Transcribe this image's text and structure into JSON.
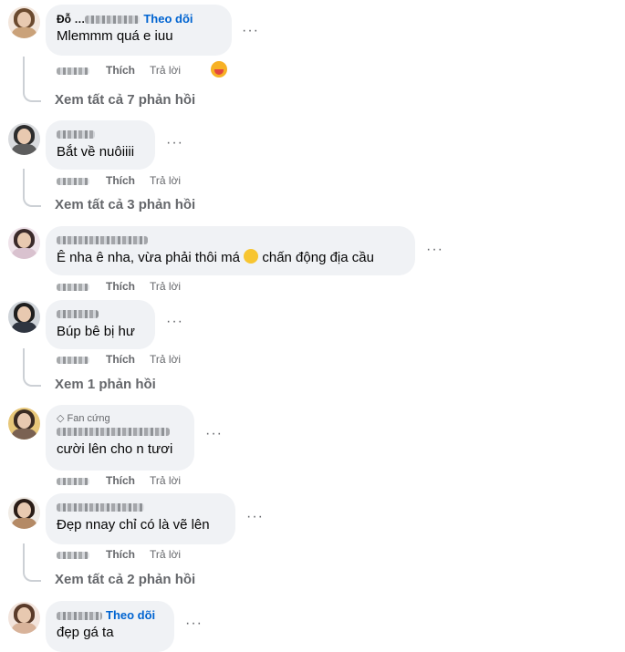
{
  "comments": [
    {
      "author": "Đỗ …",
      "follow": "Theo dõi",
      "text": "Mlemmm quá e iuu",
      "like": "Thích",
      "reply": "Trả lời",
      "replies_link": "Xem tất cả 7 phản hồi",
      "reaction_icon": "heart-hug-emoji"
    },
    {
      "author": "",
      "text": "Bắt về nuôiiii",
      "like": "Thích",
      "reply": "Trả lời",
      "replies_link": "Xem tất cả 3 phản hồi"
    },
    {
      "author": "",
      "text": "Ê nha ê nha, vừa phải thôi má",
      "text_after": "chấn động địa cầu",
      "emoji": "pleading-face-emoji",
      "like": "Thích",
      "reply": "Trả lời"
    },
    {
      "author": "",
      "text": "Búp bê bị hư",
      "like": "Thích",
      "reply": "Trả lời",
      "replies_link": "Xem 1 phản hồi"
    },
    {
      "badge": "Fan cứng",
      "author": "",
      "text": "cười lên cho n tươi",
      "like": "Thích",
      "reply": "Trả lời"
    },
    {
      "author": "",
      "text": "Đẹp nnay chỉ có là vẽ lên",
      "like": "Thích",
      "reply": "Trả lời",
      "replies_link": "Xem tất cả 2 phản hồi"
    },
    {
      "author": "",
      "follow": "Theo dõi",
      "text": "đẹp gá ta"
    }
  ],
  "more_glyph": "···",
  "colors": {
    "bubble": "#f0f2f5",
    "link": "#0064d1",
    "secondary": "#65676b"
  }
}
